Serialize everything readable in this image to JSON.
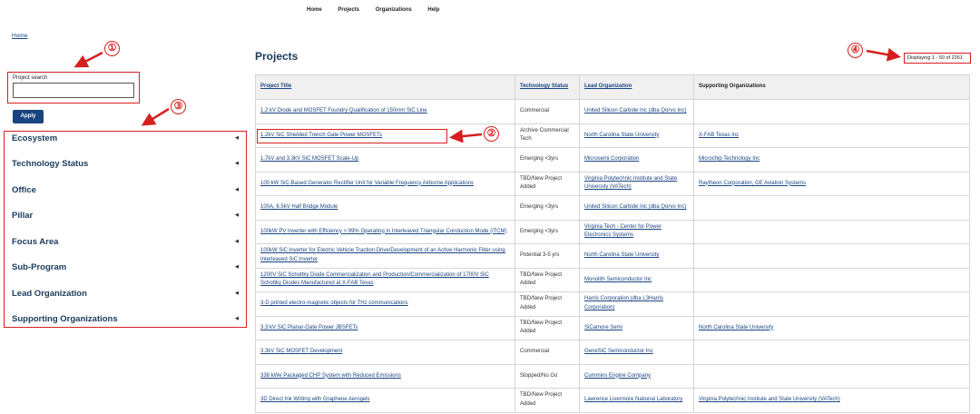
{
  "nav": {
    "items": [
      "Home",
      "Projects",
      "Organizations",
      "Help"
    ]
  },
  "breadcrumb": "Home",
  "search": {
    "label": "Project search",
    "value": "",
    "apply_label": "Apply"
  },
  "facets": [
    "Ecosystem",
    "Technology Status",
    "Office",
    "Pillar",
    "Focus Area",
    "Sub-Program",
    "Lead Organization",
    "Supporting Organizations"
  ],
  "page_title": "Projects",
  "display_count": "Displaying 1 - 50 of 2261",
  "annotations": [
    "①",
    "②",
    "③",
    "④"
  ],
  "table": {
    "headers": [
      "Project Title",
      "Technology Status",
      "Lead Organization",
      "Supporting Organizations"
    ],
    "rows": [
      {
        "title": "1.2 kV Diode and MOSFET Foundry Qualification of 150mm SiC Line",
        "status": "Commercial",
        "lead": "United Silicon Carbide Inc (dba Qorvo Inc)",
        "support": ""
      },
      {
        "title": "1.2kV SiC Shielded Trench Gate Power MOSFETs",
        "status": "Archive Commercial Tech",
        "lead": "North Carolina State University",
        "support": "X-FAB Texas Inc"
      },
      {
        "title": "1.7kV and 3.3kV SiC MOSFET Scale-Up",
        "status": "Emerging <3yrs",
        "lead": "Microsemi Corporation",
        "support": "Microchip Technology Inc"
      },
      {
        "title": "100 kW SiC-Based Generator Rectifier Unit for Variable Frequency Airborne Applications",
        "status": "TBD/New Project Added",
        "lead": "Virginia Polytechnic Institute and State University (VATech)",
        "support": "Raytheon Corporation, GE Aviation Systems"
      },
      {
        "title": "100A, 6.5kV Half Bridge Module",
        "status": "Emerging <3yrs",
        "lead": "United Silicon Carbide Inc (dba Qorvo Inc)",
        "support": ""
      },
      {
        "title": "100kW PV Inverter with Efficiency > 99% Operating in Interleaved Triangular Conduction Mode (iTCM)",
        "status": "Emerging <3yrs",
        "lead": "Virginia Tech - Center for Power Electronics Systems",
        "support": ""
      },
      {
        "title": "100kW SiC Inverter for Electric Vehicle Traction Drive/Development of an Active Harmonic Filter using Interleaved SiC Inverter",
        "status": "Potential 3-5 yrs",
        "lead": "North Carolina State University",
        "support": ""
      },
      {
        "title": "1200V SiC Schottky Diode Commercialization and Production/Commercialization of 1700V SiC Schottky Diodes Manufactured at X-FAB Texas",
        "status": "TBD/New Project Added",
        "lead": "Monolith Semiconductor Inc",
        "support": ""
      },
      {
        "title": "3-D printed electro-magnetic objects for THz communications",
        "status": "TBD/New Project Added",
        "lead": "Harris Corporation (dba L3Harris Corporation)",
        "support": ""
      },
      {
        "title": "3.3 kV SiC Planar-Gate Power JBSFETs",
        "status": "TBD/New Project Added",
        "lead": "SiCamore Semi",
        "support": "North Carolina State University"
      },
      {
        "title": "3.3kV SiC MOSFET Development",
        "status": "Commercial",
        "lead": "GeneSiC Semiconductor Inc",
        "support": ""
      },
      {
        "title": "338 kWe Packaged CHP System with Reduced Emissions",
        "status": "Stopped/No Go",
        "lead": "Cummins Engine Company",
        "support": ""
      },
      {
        "title": "3D Direct Ink Writing with Graphene Aerogels",
        "status": "TBD/New Project Added",
        "lead": "Lawrence Livermore National Laboratory",
        "support": "Virginia Polytechnic Institute and State University (VATech)"
      }
    ]
  },
  "colors": {
    "accent": "#1a4480",
    "annotation": "#d61f1f",
    "heading": "#1a3a5c"
  }
}
